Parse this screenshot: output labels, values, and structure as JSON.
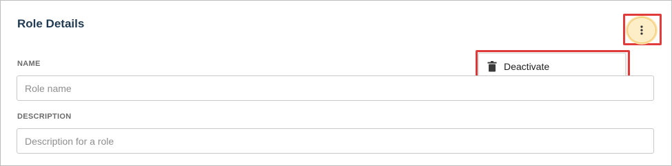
{
  "panel": {
    "title": "Role Details"
  },
  "actions": {
    "more_icon": "vertical-ellipsis-icon",
    "highlight_color": "#e23b3b",
    "button_bg": "#fdeec7"
  },
  "menu": {
    "items": [
      {
        "label": "Deactivate",
        "icon": "trash-icon"
      }
    ]
  },
  "fields": {
    "name": {
      "label": "NAME",
      "value": "",
      "placeholder": "Role name"
    },
    "description": {
      "label": "DESCRIPTION",
      "value": "",
      "placeholder": "Description for a role"
    }
  }
}
